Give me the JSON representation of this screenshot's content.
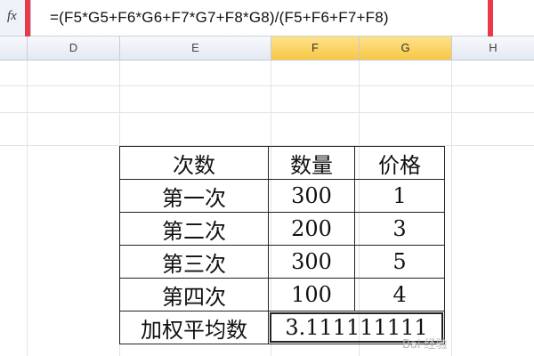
{
  "formula_bar": {
    "fx_label": "fx",
    "formula": "=(F5*G5+F6*G6+F7*G7+F8*G8)/(F5+F6+F7+F8)"
  },
  "column_headers": [
    "D",
    "E",
    "F",
    "G",
    "H"
  ],
  "selected_columns": [
    "F",
    "G"
  ],
  "table": {
    "header": [
      "次数",
      "数量",
      "价格"
    ],
    "rows": [
      [
        "第一次",
        "300",
        "1"
      ],
      [
        "第二次",
        "200",
        "3"
      ],
      [
        "第三次",
        "300",
        "5"
      ],
      [
        "第四次",
        "100",
        "4"
      ]
    ],
    "result_label": "加权平均数",
    "result_value": "3.111111111"
  },
  "watermark": "Bai 经验",
  "colors": {
    "highlight_frame": "#e83a4a",
    "selected_header": "#f7c745",
    "gridline": "#dfe4ea"
  }
}
